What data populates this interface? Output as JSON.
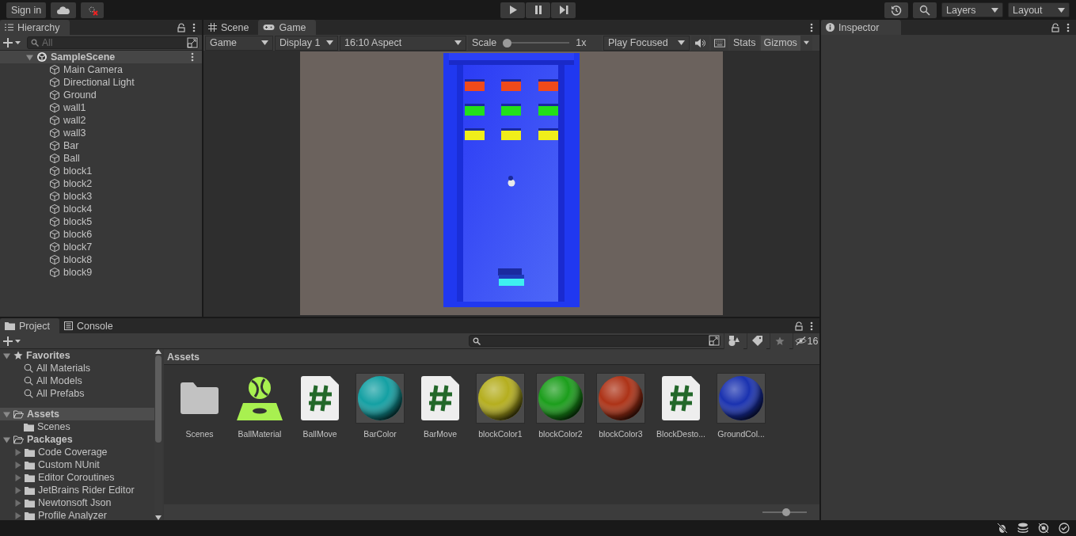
{
  "toolbar": {
    "sign_in": "Sign in",
    "layers": "Layers",
    "layout": "Layout"
  },
  "hierarchy": {
    "tab": "Hierarchy",
    "search": {
      "placeholder": "All"
    },
    "scene": {
      "name": "SampleScene",
      "expanded": true,
      "children": [
        "Main Camera",
        "Directional Light",
        "Ground",
        "wall1",
        "wall2",
        "wall3",
        "Bar",
        "Ball",
        "block1",
        "block2",
        "block3",
        "block4",
        "block5",
        "block6",
        "block7",
        "block8",
        "block9"
      ]
    }
  },
  "game": {
    "tabs": [
      {
        "label": "Scene",
        "selected": false
      },
      {
        "label": "Game",
        "selected": true
      }
    ],
    "toolbar": {
      "view": "Game",
      "display": "Display 1",
      "aspect": "16:10 Aspect",
      "scale_label": "Scale",
      "scale_slider": {
        "level": 0
      },
      "scale_value": "1x",
      "play_mode": "Play Focused",
      "stats": "Stats",
      "gizmos": "Gizmos"
    }
  },
  "inspector": {
    "tab": "Inspector"
  },
  "project": {
    "tabs": [
      {
        "label": "Project",
        "selected": true
      },
      {
        "label": "Console",
        "selected": false
      }
    ],
    "hidden_count": "16",
    "icon_size": {
      "level": 0.55
    },
    "tree": [
      {
        "label": "Favorites",
        "kind": "favorites",
        "selected": false,
        "expanded": true,
        "children": [
          {
            "label": "All Materials",
            "kind": "search",
            "selected": false
          },
          {
            "label": "All Models",
            "kind": "search",
            "selected": false
          },
          {
            "label": "All Prefabs",
            "kind": "search",
            "selected": false
          }
        ]
      },
      {
        "label": "Assets",
        "kind": "folder",
        "selected": true,
        "expanded": true,
        "children": [
          {
            "label": "Scenes",
            "kind": "folder",
            "selected": false
          }
        ]
      },
      {
        "label": "Packages",
        "kind": "folder",
        "selected": false,
        "expanded": true,
        "children": [
          {
            "label": "Code Coverage",
            "kind": "folder",
            "selected": false,
            "expanded": false
          },
          {
            "label": "Custom NUnit",
            "kind": "folder",
            "selected": false,
            "expanded": false
          },
          {
            "label": "Editor Coroutines",
            "kind": "folder",
            "selected": false,
            "expanded": false
          },
          {
            "label": "JetBrains Rider Editor",
            "kind": "folder",
            "selected": false,
            "expanded": false
          },
          {
            "label": "Newtonsoft Json",
            "kind": "folder",
            "selected": false,
            "expanded": false
          },
          {
            "label": "Profile Analyzer",
            "kind": "folder",
            "selected": false,
            "expanded": false
          }
        ]
      }
    ],
    "breadcrumb": "Assets",
    "assets": [
      {
        "name": "Scenes",
        "kind": "folder"
      },
      {
        "name": "BallMaterial",
        "kind": "physics-material"
      },
      {
        "name": "BallMove",
        "kind": "script"
      },
      {
        "name": "BarColor",
        "kind": "material",
        "color": "#14a0a3"
      },
      {
        "name": "BarMove",
        "kind": "script"
      },
      {
        "name": "blockColor1",
        "kind": "material",
        "color": "#b5ae1f"
      },
      {
        "name": "blockColor2",
        "kind": "material",
        "color": "#1c9e1c"
      },
      {
        "name": "blockColor3",
        "kind": "material",
        "color": "#ad3317"
      },
      {
        "name": "BlockDesto...",
        "kind": "script"
      },
      {
        "name": "GroundCol...",
        "kind": "material",
        "color": "#1a32b0"
      }
    ]
  }
}
